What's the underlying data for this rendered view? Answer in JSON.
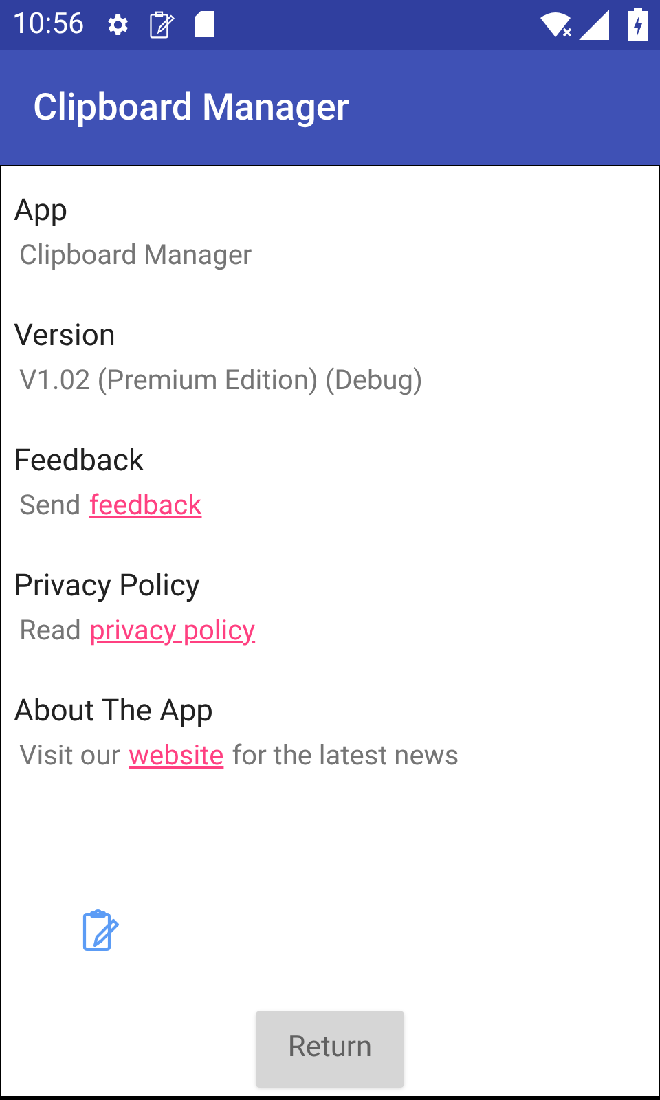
{
  "status_bar": {
    "time": "10:56"
  },
  "app_bar": {
    "title": "Clipboard Manager"
  },
  "sections": [
    {
      "title": "App",
      "parts": [
        {
          "kind": "text",
          "text": "Clipboard Manager"
        }
      ]
    },
    {
      "title": "Version",
      "parts": [
        {
          "kind": "text",
          "text": "V1.02 (Premium Edition) (Debug)"
        }
      ]
    },
    {
      "title": "Feedback",
      "parts": [
        {
          "kind": "text",
          "text": "Send"
        },
        {
          "kind": "link",
          "text": "feedback"
        }
      ]
    },
    {
      "title": "Privacy Policy",
      "parts": [
        {
          "kind": "text",
          "text": "Read"
        },
        {
          "kind": "link",
          "text": "privacy policy"
        }
      ]
    },
    {
      "title": "About The App",
      "parts": [
        {
          "kind": "text",
          "text": "Visit our"
        },
        {
          "kind": "link",
          "text": "website"
        },
        {
          "kind": "text",
          "text": "for the latest news"
        }
      ]
    }
  ],
  "button": {
    "label": "Return"
  }
}
